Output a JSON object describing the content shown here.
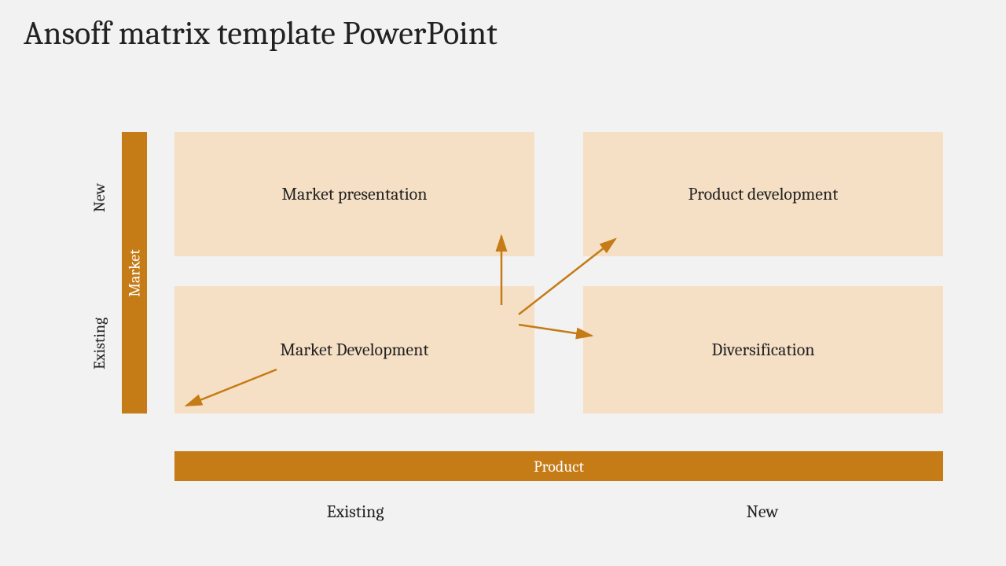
{
  "title": "Ansoff matrix template PowerPoint",
  "axis_vertical": {
    "label": "Market",
    "top": "New",
    "bottom": "Existing"
  },
  "axis_horizontal": {
    "label": "Product",
    "left": "Existing",
    "right": "New"
  },
  "cells": {
    "top_left": "Market presentation",
    "top_right": "Product development",
    "bottom_left": "Market Development",
    "bottom_right": "Diversification"
  },
  "colors": {
    "bar": "#c57b16",
    "cell_bg": "#f6e0c5",
    "slide_bg": "#f2f2f2",
    "text": "#222222"
  }
}
